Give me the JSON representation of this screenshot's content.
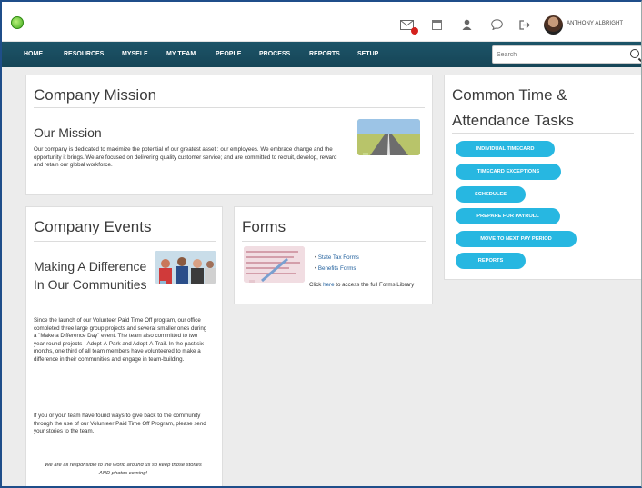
{
  "header": {
    "user_name": "ANTHONY ALBRIGHT"
  },
  "nav": {
    "items": [
      "HOME",
      "RESOURCES",
      "MYSELF",
      "MY TEAM",
      "PEOPLE",
      "PROCESS",
      "REPORTS",
      "SETUP"
    ]
  },
  "search": {
    "placeholder": "Search"
  },
  "mission": {
    "title": "Company Mission",
    "heading": "Our Mission",
    "text": "Our company is dedicated to maximize the potential of our greatest asset : our employees. We embrace change and the opportunity it brings. We are focused on delivering quality customer service; and are committed to recruit, develop, reward and retain our global workforce."
  },
  "events": {
    "title": "Company Events",
    "heading": "Making A Difference In Our Communities",
    "paragraph1": "Since the launch of our Volunteer Paid Time Off program, our office completed three large group projects and several smaller ones during a \"Make a Difference Day\" event.  The team also committed to two year-round projects - Adopt-A-Park and Adopt-A-Trail.  In the past six months, one third of all team members have volunteered to make a difference in their communities and engage in team-building.",
    "paragraph2": "If you or your team have found ways to give back to the community through the use of our Volunteer Paid Time Off Program, please send your stories to the team.",
    "footnote": "We are all responsible to the world around us so keep those stories AND photos coming!"
  },
  "forms": {
    "title": "Forms",
    "links": [
      "State Tax Forms",
      "Benefits Forms"
    ],
    "footer_prefix": "Click ",
    "footer_link": "here",
    "footer_suffix": " to access the full Forms Library"
  },
  "tasks": {
    "title_line1": "Common Time &",
    "title_line2": "Attendance Tasks",
    "buttons": [
      "INDIVIDUAL TIMECARD",
      "TIMECARD EXCEPTIONS",
      "SCHEDULES",
      "PREPARE FOR PAYROLL",
      "MOVE TO NEXT PAY PERIOD",
      "REPORTS"
    ]
  },
  "colors": {
    "nav_bg": "#1d5468",
    "task_button": "#27b7e1",
    "link": "#1e5e9c"
  }
}
